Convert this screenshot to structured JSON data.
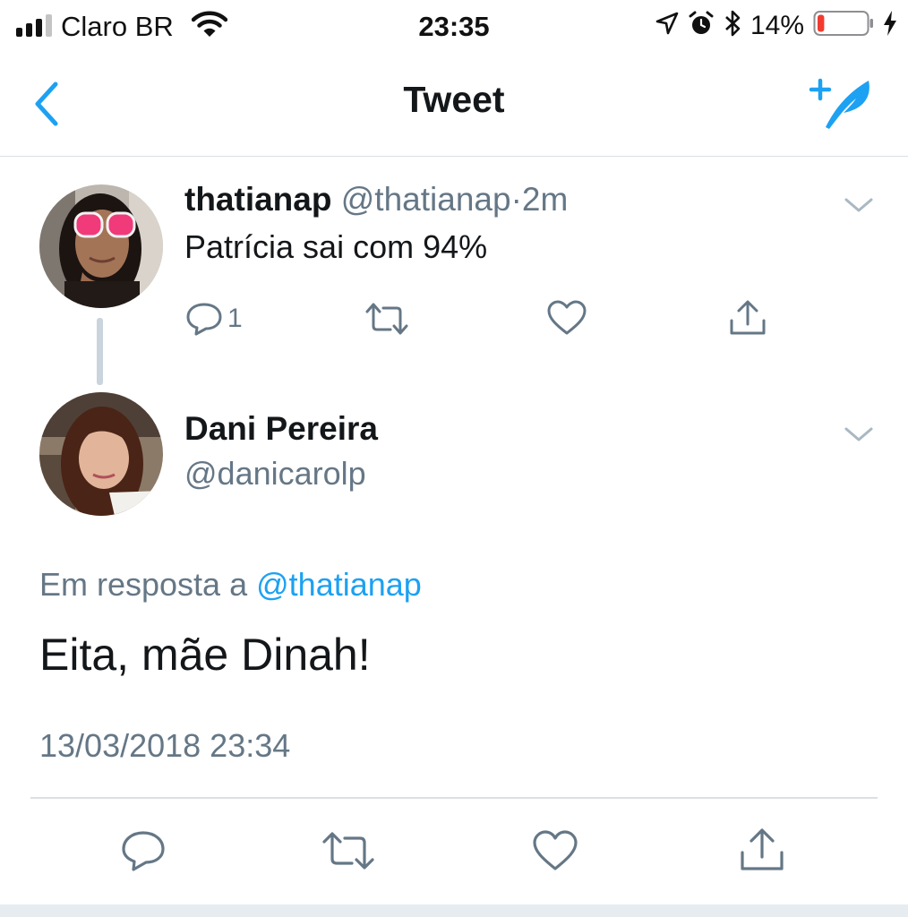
{
  "status_bar": {
    "carrier": "Claro BR",
    "time": "23:35",
    "battery_percent": "14%",
    "signal_bars_active": 3,
    "signal_bars_total": 4,
    "battery_level": 0.14,
    "icons": [
      "signal-icon",
      "wifi-icon",
      "location-icon",
      "alarm-icon",
      "bluetooth-icon",
      "battery-icon",
      "charging-icon"
    ]
  },
  "nav": {
    "title": "Tweet",
    "back_icon": "chevron-left-icon",
    "compose_icon": "compose-tweet-icon"
  },
  "parent_tweet": {
    "name": "thatianap",
    "handle": "@thatianap",
    "separator": "·",
    "time_ago": "2m",
    "text": "Patrícia sai com 94%",
    "reply_count": "1"
  },
  "main_tweet": {
    "name": "Dani Pereira",
    "handle": "@danicarolp",
    "in_reply_prefix": "Em resposta a",
    "in_reply_mention": "@thatianap",
    "text": "Eita, mãe Dinah!",
    "timestamp": "13/03/2018 23:34"
  },
  "colors": {
    "accent": "#1da1f2",
    "text_primary": "#14171a",
    "text_muted": "#657786",
    "divider": "#dcdfe3",
    "battery_low": "#f23b30"
  }
}
